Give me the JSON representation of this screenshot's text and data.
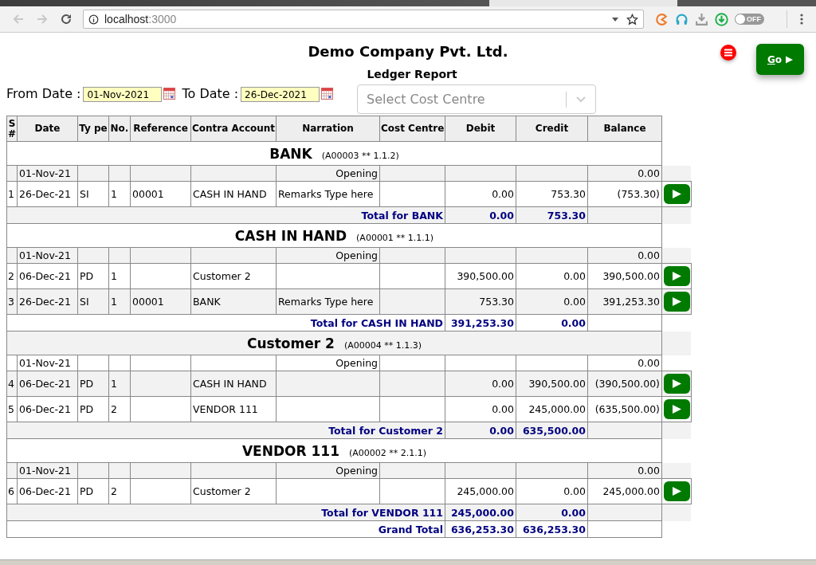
{
  "browser": {
    "host": "localhost",
    "port": ":3000",
    "toggle": "OFF",
    "on": false
  },
  "header": {
    "company": "Demo Company Pvt. Ltd.",
    "report_title": "Ledger Report"
  },
  "filters": {
    "from_label": "From Date :",
    "from_date": "01-Nov-2021",
    "to_label": "To Date :",
    "to_date": "26-Dec-2021",
    "cost_centre": {
      "placeholder": "Select Cost Centre"
    }
  },
  "go_button": {
    "label": "Go"
  },
  "table": {
    "columns": [
      "S #",
      "Date",
      "Ty pe",
      "No.",
      "Reference",
      "Contra Account",
      "Narration",
      "Cost Centre",
      "Debit",
      "Credit",
      "Balance"
    ],
    "groups": [
      {
        "name": "BANK",
        "code": "(A00003 ** 1.1.2)",
        "opening": {
          "date": "01-Nov-21",
          "label": "Opening",
          "balance": "0.00"
        },
        "rows": [
          {
            "sn": "1",
            "date": "26-Dec-21",
            "type": "SI",
            "no": "1",
            "reference": "00001",
            "contra": "CASH IN HAND",
            "narration": "Remarks Type here",
            "debit": "0.00",
            "credit": "753.30",
            "balance": "(753.30)"
          }
        ],
        "total": {
          "label": "Total for BANK",
          "debit": "0.00",
          "credit": "753.30"
        }
      },
      {
        "name": "CASH IN HAND",
        "code": "(A00001 ** 1.1.1)",
        "opening": {
          "date": "01-Nov-21",
          "label": "Opening",
          "balance": "0.00"
        },
        "rows": [
          {
            "sn": "2",
            "date": "06-Dec-21",
            "type": "PD",
            "no": "1",
            "reference": "",
            "contra": "Customer 2",
            "narration": "",
            "debit": "390,500.00",
            "credit": "0.00",
            "balance": "390,500.00"
          },
          {
            "sn": "3",
            "date": "26-Dec-21",
            "type": "SI",
            "no": "1",
            "reference": "00001",
            "contra": "BANK",
            "narration": "Remarks Type here",
            "debit": "753.30",
            "credit": "0.00",
            "balance": "391,253.30"
          }
        ],
        "total": {
          "label": "Total for CASH IN HAND",
          "debit": "391,253.30",
          "credit": "0.00"
        }
      },
      {
        "name": "Customer 2",
        "code": "(A00004 ** 1.1.3)",
        "opening": {
          "date": "01-Nov-21",
          "label": "Opening",
          "balance": "0.00"
        },
        "rows": [
          {
            "sn": "4",
            "date": "06-Dec-21",
            "type": "PD",
            "no": "1",
            "reference": "",
            "contra": "CASH IN HAND",
            "narration": "",
            "debit": "0.00",
            "credit": "390,500.00",
            "balance": "(390,500.00)"
          },
          {
            "sn": "5",
            "date": "06-Dec-21",
            "type": "PD",
            "no": "2",
            "reference": "",
            "contra": "VENDOR 111",
            "narration": "",
            "debit": "0.00",
            "credit": "245,000.00",
            "balance": "(635,500.00)"
          }
        ],
        "total": {
          "label": "Total for Customer 2",
          "debit": "0.00",
          "credit": "635,500.00"
        }
      },
      {
        "name": "VENDOR 111",
        "code": "(A00002 ** 2.1.1)",
        "opening": {
          "date": "01-Nov-21",
          "label": "Opening",
          "balance": "0.00"
        },
        "rows": [
          {
            "sn": "6",
            "date": "06-Dec-21",
            "type": "PD",
            "no": "2",
            "reference": "",
            "contra": "Customer 2",
            "narration": "",
            "debit": "245,000.00",
            "credit": "0.00",
            "balance": "245,000.00"
          }
        ],
        "total": {
          "label": "Total for VENDOR 111",
          "debit": "245,000.00",
          "credit": "0.00"
        }
      }
    ],
    "grand_total": {
      "label": "Grand Total",
      "debit": "636,253.30",
      "credit": "636,253.30"
    }
  }
}
